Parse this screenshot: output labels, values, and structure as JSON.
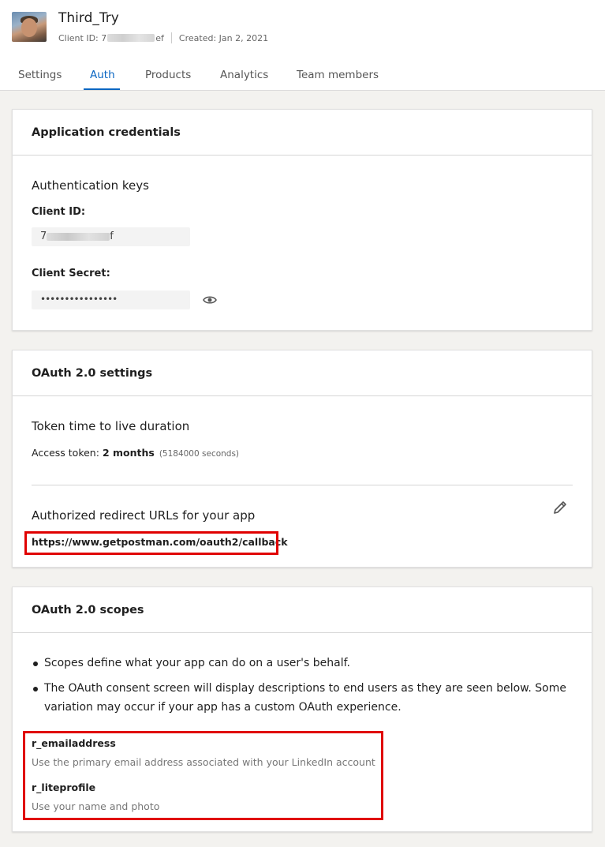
{
  "app": {
    "title": "Third_Try",
    "client_id_prefix": "Client ID: 7",
    "client_id_suffix": "ef",
    "created": "Created: Jan 2, 2021"
  },
  "tabs": [
    {
      "label": "Settings",
      "active": false
    },
    {
      "label": "Auth",
      "active": true
    },
    {
      "label": "Products",
      "active": false
    },
    {
      "label": "Analytics",
      "active": false
    },
    {
      "label": "Team members",
      "active": false
    }
  ],
  "credentials": {
    "title": "Application credentials",
    "section_heading": "Authentication keys",
    "client_id_label": "Client ID:",
    "client_id_value_prefix": "7",
    "client_id_value_suffix": "f",
    "client_secret_label": "Client Secret:",
    "client_secret_value": "••••••••••••••••",
    "reveal_icon": "eye-icon"
  },
  "oauth_settings": {
    "title": "OAuth 2.0 settings",
    "token_heading": "Token time to live duration",
    "access_token_label": "Access token:",
    "access_token_value": "2 months",
    "access_token_seconds": "(5184000 seconds)",
    "redirect_heading": "Authorized redirect URLs for your app",
    "redirect_url": "https://www.getpostman.com/oauth2/callback",
    "edit_icon": "pencil-icon"
  },
  "oauth_scopes": {
    "title": "OAuth 2.0 scopes",
    "bullets": [
      "Scopes define what your app can do on a user's behalf.",
      "The OAuth consent screen will display descriptions to end users as they are seen below. Some variation may occur if your app has a custom OAuth experience."
    ],
    "scopes": [
      {
        "name": "r_emailaddress",
        "description": "Use the primary email address associated with your LinkedIn account"
      },
      {
        "name": "r_liteprofile",
        "description": "Use your name and photo"
      }
    ]
  },
  "colors": {
    "accent": "#0a66c2",
    "highlight": "#e00000",
    "page_bg": "#f3f2ef"
  }
}
